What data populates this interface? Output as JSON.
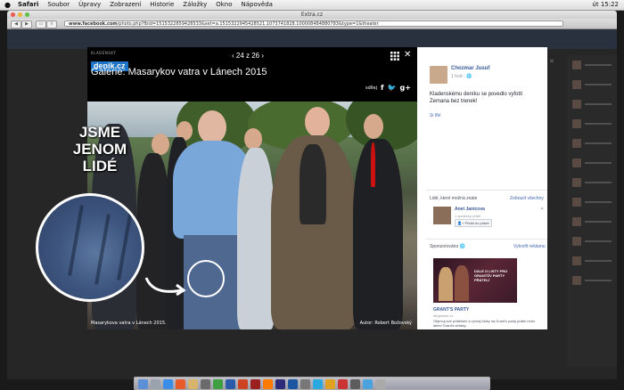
{
  "menubar": {
    "apple": "",
    "items": [
      "Safari",
      "Soubor",
      "Úpravy",
      "Zobrazení",
      "Historie",
      "Záložky",
      "Okno",
      "Nápověda"
    ],
    "clock": "út 15:22"
  },
  "browser": {
    "window_title": "Extra.cz",
    "url_host": "www.facebook.com",
    "url_path": "/photo.php?fbid=1515322859428533&set=a.1515322945428521.1073741828.100008484880783&type=1&theater"
  },
  "theater": {
    "logo_top": "KLADENSKÝ",
    "logo_name": "denik.cz",
    "counter": "‹ 24 z 26 ›",
    "gallery_title": "Galerie: Masarykov vatra v Lánech 2015",
    "share_label": "sdílej",
    "photo_caption": "Masarykova vatra v Lánech 2015.",
    "photo_author": "Autor: Robert Božovský",
    "overlay_text": "JSME JENOM LIDÉ"
  },
  "sidepanel": {
    "poster_name": "Chozmar Jusuf",
    "post_time": "1 hod · 🌐",
    "post_text": "Kladenskému deníku se povedlo vyfotit Zemana bez trenek!",
    "like_label": "Si líbí",
    "pymk_title": "Lidé, které možná znáte",
    "show_all": "Zobrazit všechny",
    "person_name": "Anet Janicova",
    "mutual": "1 společný přítel",
    "add_friend": "Přidat do přátel",
    "sponsored": "Sponzorováno 🌐",
    "create_ad": "Vytvořit reklamu",
    "ad_image_text": "DÁLE O LISTY PRO GRANTŮV PARTY PŘÁTELÍ",
    "ad_title": "GRANT'S PARTY",
    "ad_domain": "dlnykamo.cz",
    "ad_desc": "Objevuj své přátelství a vyhraj lístky na Grant's party přátel nebo lahev Grant's whisky."
  },
  "colors": {
    "facebook_blue": "#3b5998",
    "link_blue": "#4267b2",
    "denik_blue": "#1e74c6"
  }
}
